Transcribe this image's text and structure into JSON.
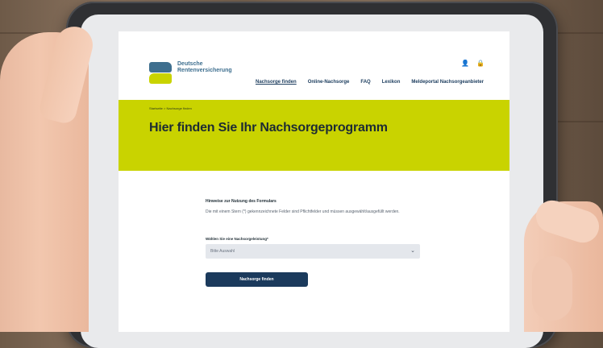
{
  "brand": {
    "line1": "Deutsche",
    "line2": "Rentenversicherung"
  },
  "header_icons": [
    "person-icon",
    "lock-icon"
  ],
  "nav": [
    {
      "label": "Nachsorge finden",
      "active": true
    },
    {
      "label": "Online-Nachsorge",
      "active": false
    },
    {
      "label": "FAQ",
      "active": false
    },
    {
      "label": "Lexikon",
      "active": false
    },
    {
      "label": "Meldeportal Nachsorgeanbieter",
      "active": false
    }
  ],
  "breadcrumb": {
    "home": "Startseite",
    "sep": ">",
    "current": "Nachsorge finden"
  },
  "hero": {
    "title": "Hier finden Sie Ihr Nachsorgeprogramm"
  },
  "form": {
    "hint_title": "Hinweise zur Nutzung des Formulars",
    "hint_text": "Die mit einem Stern (*) gekennzeichnete Felder sind Pflichtfelder und müssen ausgewählt/ausgefüllt werden.",
    "select_label": "Wählen Sie eine Nachsorgeleistung*",
    "select_value": "Bitte Auswahl",
    "submit_label": "Nachsorge finden"
  },
  "colors": {
    "accent_lime": "#c9d300",
    "brand_blue": "#3e6f8f",
    "button_navy": "#1b3a5c"
  }
}
